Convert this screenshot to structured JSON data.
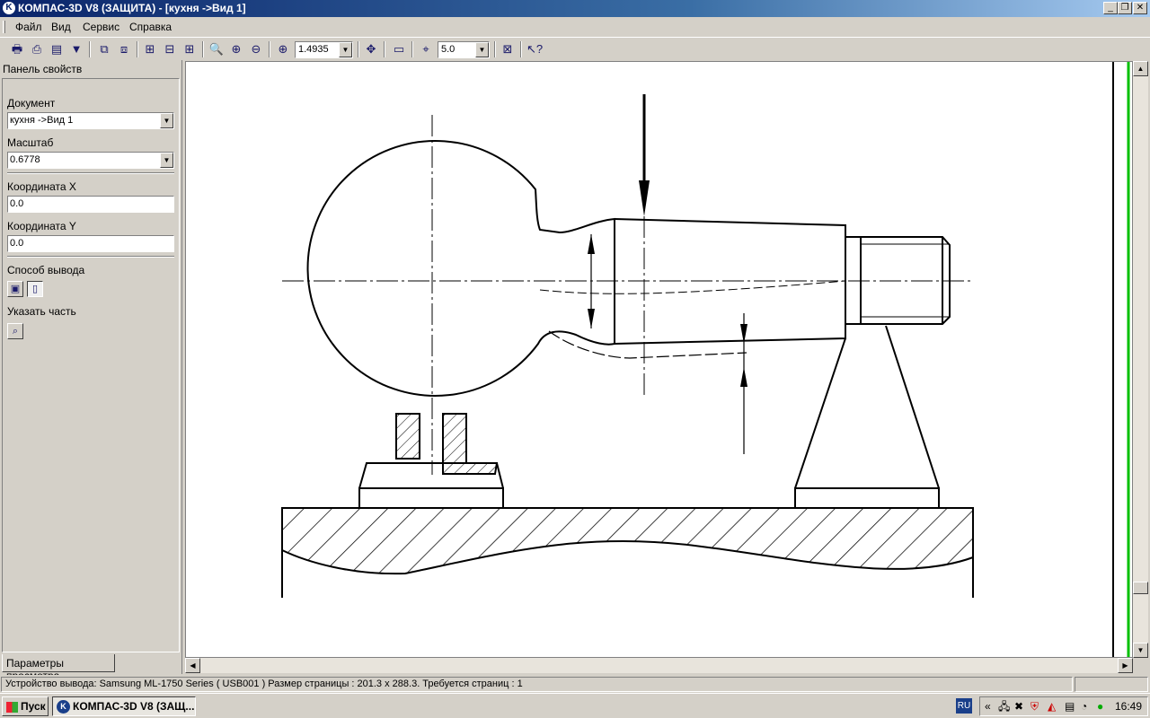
{
  "window": {
    "title": "КОМПАС-3D V8 (ЗАЩИТА) - [кухня ->Вид 1]"
  },
  "menu": [
    "Файл",
    "Вид",
    "Сервис",
    "Справка"
  ],
  "toolbar": {
    "zoom_value": "1.4935",
    "step_value": "5.0"
  },
  "panel": {
    "title": "Панель свойств",
    "document_label": "Документ",
    "document_value": "кухня ->Вид 1",
    "scale_label": "Масштаб",
    "scale_value": "0.6778",
    "coord_x_label": "Координата X",
    "coord_x_value": "0.0",
    "coord_y_label": "Координата Y",
    "coord_y_value": "0.0",
    "output_mode_label": "Способ вывода",
    "select_part_label": "Указать часть",
    "tab_label": "Параметры просмотра"
  },
  "status": {
    "text": "Устройство вывода: Samsung ML-1750 Series ( USB001 )  Размер страницы : 201.3 x 288.3.  Требуется страниц : 1"
  },
  "taskbar": {
    "start_label": "Пуск",
    "task_label": "КОМПАС-3D V8 (ЗАЩ...",
    "lang": "RU",
    "clock": "16:49"
  }
}
